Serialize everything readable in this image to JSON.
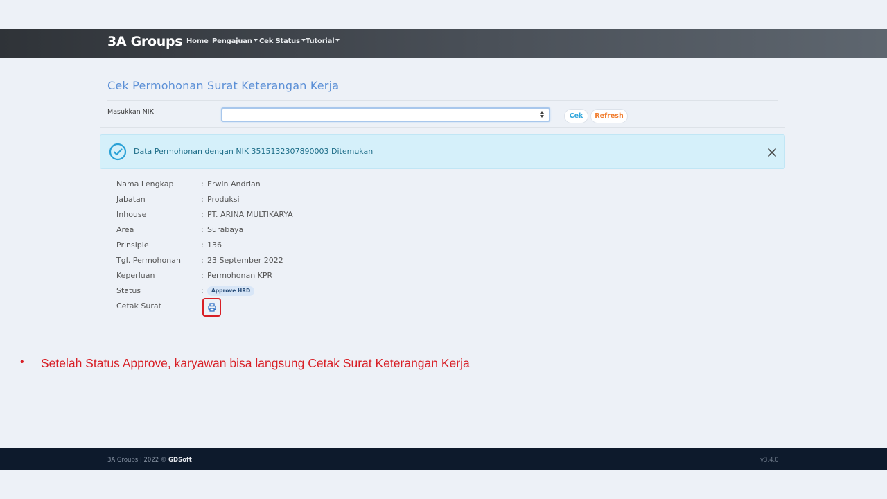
{
  "navbar": {
    "brand": "3A Groups",
    "links": [
      "Home",
      "Pengajuan",
      "Cek Status",
      "Tutorial"
    ]
  },
  "page": {
    "title": "Cek Permohonan Surat Keterangan Kerja",
    "nik_label": "Masukkan NIK :",
    "nik_value": "",
    "cek_button": "Cek",
    "refresh_button": "Refresh"
  },
  "alert": {
    "message": "Data Permohonan dengan NIK 3515132307890003 Ditemukan",
    "icon": "check-circle-icon",
    "color": "#d5f0fa"
  },
  "details": {
    "colon": ":",
    "rows": [
      {
        "label": "Nama Lengkap",
        "value": "Erwin Andrian"
      },
      {
        "label": "Jabatan",
        "value": "Produksi"
      },
      {
        "label": "Inhouse",
        "value": "PT. ARINA MULTIKARYA"
      },
      {
        "label": "Area",
        "value": "Surabaya"
      },
      {
        "label": "Prinsiple",
        "value": "136"
      },
      {
        "label": "Tgl. Permohonan",
        "value": "23 September 2022"
      },
      {
        "label": "Keperluan",
        "value": "Permohonan KPR"
      }
    ],
    "status_label": "Status",
    "status_value": "Approve HRD",
    "print_label": "Cetak Surat",
    "print_icon": "printer-icon"
  },
  "annotation": {
    "bullet": "•",
    "text": "Setelah Status Approve, karyawan bisa langsung Cetak Surat Keterangan Kerja",
    "color": "#d81f26"
  },
  "footer": {
    "copyright": "3A Groups | 2022 ©",
    "company": "GDSoft",
    "version": "v3.4.0"
  }
}
